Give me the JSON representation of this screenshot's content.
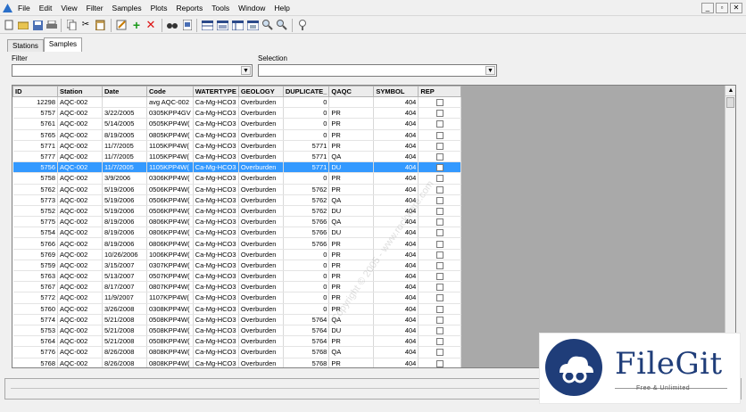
{
  "menu": [
    "File",
    "Edit",
    "View",
    "Filter",
    "Samples",
    "Plots",
    "Reports",
    "Tools",
    "Window",
    "Help"
  ],
  "window_buttons": [
    "_",
    "▫",
    "✕"
  ],
  "tabs": [
    "Stations",
    "Samples"
  ],
  "filter": {
    "label": "Filter",
    "value": ""
  },
  "selection": {
    "label": "Selection",
    "value": ""
  },
  "columns": [
    "ID",
    "Station",
    "Date",
    "Code",
    "WATERTYPE",
    "GEOLOGY",
    "DUPLICATE_",
    "QAQC",
    "SYMBOL",
    "REP"
  ],
  "rows": [
    {
      "id": "12298",
      "station": "AQC-002",
      "date": "",
      "code": "avg AQC-002",
      "watertype": "Ca-Mg-HCO3",
      "geology": "Overburden",
      "dup": "0",
      "qaqc": "",
      "symbol": "404"
    },
    {
      "id": "5757",
      "station": "AQC-002",
      "date": "3/22/2005",
      "code": "0305KPP4GV",
      "watertype": "Ca-Mg-HCO3",
      "geology": "Overburden",
      "dup": "0",
      "qaqc": "PR",
      "symbol": "404"
    },
    {
      "id": "5761",
      "station": "AQC-002",
      "date": "5/14/2005",
      "code": "0505KPP4W(",
      "watertype": "Ca-Mg-HCO3",
      "geology": "Overburden",
      "dup": "0",
      "qaqc": "PR",
      "symbol": "404"
    },
    {
      "id": "5765",
      "station": "AQC-002",
      "date": "8/19/2005",
      "code": "0805KPP4W(",
      "watertype": "Ca-Mg-HCO3",
      "geology": "Overburden",
      "dup": "0",
      "qaqc": "PR",
      "symbol": "404"
    },
    {
      "id": "5771",
      "station": "AQC-002",
      "date": "11/7/2005",
      "code": "1105KPP4W(",
      "watertype": "Ca-Mg-HCO3",
      "geology": "Overburden",
      "dup": "5771",
      "qaqc": "PR",
      "symbol": "404"
    },
    {
      "id": "5777",
      "station": "AQC-002",
      "date": "11/7/2005",
      "code": "1105KPP4W(",
      "watertype": "Ca-Mg-HCO3",
      "geology": "Overburden",
      "dup": "5771",
      "qaqc": "QA",
      "symbol": "404"
    },
    {
      "id": "5756",
      "station": "AQC-002",
      "date": "11/7/2005",
      "code": "1105KPP4W(",
      "watertype": "Ca-Mg-HCO3",
      "geology": "Overburden",
      "dup": "5771",
      "qaqc": "DU",
      "symbol": "404",
      "selected": true
    },
    {
      "id": "5758",
      "station": "AQC-002",
      "date": "3/9/2006",
      "code": "0306KPP4W(",
      "watertype": "Ca-Mg-HCO3",
      "geology": "Overburden",
      "dup": "0",
      "qaqc": "PR",
      "symbol": "404"
    },
    {
      "id": "5762",
      "station": "AQC-002",
      "date": "5/19/2006",
      "code": "0506KPP4W(",
      "watertype": "Ca-Mg-HCO3",
      "geology": "Overburden",
      "dup": "5762",
      "qaqc": "PR",
      "symbol": "404"
    },
    {
      "id": "5773",
      "station": "AQC-002",
      "date": "5/19/2006",
      "code": "0506KPP4W(",
      "watertype": "Ca-Mg-HCO3",
      "geology": "Overburden",
      "dup": "5762",
      "qaqc": "QA",
      "symbol": "404"
    },
    {
      "id": "5752",
      "station": "AQC-002",
      "date": "5/19/2006",
      "code": "0506KPP4W(",
      "watertype": "Ca-Mg-HCO3",
      "geology": "Overburden",
      "dup": "5762",
      "qaqc": "DU",
      "symbol": "404"
    },
    {
      "id": "5775",
      "station": "AQC-002",
      "date": "8/19/2006",
      "code": "0806KPP4W(",
      "watertype": "Ca-Mg-HCO3",
      "geology": "Overburden",
      "dup": "5766",
      "qaqc": "QA",
      "symbol": "404"
    },
    {
      "id": "5754",
      "station": "AQC-002",
      "date": "8/19/2006",
      "code": "0806KPP4W(",
      "watertype": "Ca-Mg-HCO3",
      "geology": "Overburden",
      "dup": "5766",
      "qaqc": "DU",
      "symbol": "404"
    },
    {
      "id": "5766",
      "station": "AQC-002",
      "date": "8/19/2006",
      "code": "0806KPP4W(",
      "watertype": "Ca-Mg-HCO3",
      "geology": "Overburden",
      "dup": "5766",
      "qaqc": "PR",
      "symbol": "404"
    },
    {
      "id": "5769",
      "station": "AQC-002",
      "date": "10/26/2006",
      "code": "1006KPP4W(",
      "watertype": "Ca-Mg-HCO3",
      "geology": "Overburden",
      "dup": "0",
      "qaqc": "PR",
      "symbol": "404"
    },
    {
      "id": "5759",
      "station": "AQC-002",
      "date": "3/15/2007",
      "code": "0307KPP4W(",
      "watertype": "Ca-Mg-HCO3",
      "geology": "Overburden",
      "dup": "0",
      "qaqc": "PR",
      "symbol": "404"
    },
    {
      "id": "5763",
      "station": "AQC-002",
      "date": "5/13/2007",
      "code": "0507KPP4W(",
      "watertype": "Ca-Mg-HCO3",
      "geology": "Overburden",
      "dup": "0",
      "qaqc": "PR",
      "symbol": "404"
    },
    {
      "id": "5767",
      "station": "AQC-002",
      "date": "8/17/2007",
      "code": "0807KPP4W(",
      "watertype": "Ca-Mg-HCO3",
      "geology": "Overburden",
      "dup": "0",
      "qaqc": "PR",
      "symbol": "404"
    },
    {
      "id": "5772",
      "station": "AQC-002",
      "date": "11/9/2007",
      "code": "1107KPP4W(",
      "watertype": "Ca-Mg-HCO3",
      "geology": "Overburden",
      "dup": "0",
      "qaqc": "PR",
      "symbol": "404"
    },
    {
      "id": "5760",
      "station": "AQC-002",
      "date": "3/26/2008",
      "code": "0308KPP4W(",
      "watertype": "Ca-Mg-HCO3",
      "geology": "Overburden",
      "dup": "0",
      "qaqc": "PR",
      "symbol": "404"
    },
    {
      "id": "5774",
      "station": "AQC-002",
      "date": "5/21/2008",
      "code": "0508KPP4W(",
      "watertype": "Ca-Mg-HCO3",
      "geology": "Overburden",
      "dup": "5764",
      "qaqc": "QA",
      "symbol": "404"
    },
    {
      "id": "5753",
      "station": "AQC-002",
      "date": "5/21/2008",
      "code": "0508KPP4W(",
      "watertype": "Ca-Mg-HCO3",
      "geology": "Overburden",
      "dup": "5764",
      "qaqc": "DU",
      "symbol": "404"
    },
    {
      "id": "5764",
      "station": "AQC-002",
      "date": "5/21/2008",
      "code": "0508KPP4W(",
      "watertype": "Ca-Mg-HCO3",
      "geology": "Overburden",
      "dup": "5764",
      "qaqc": "PR",
      "symbol": "404"
    },
    {
      "id": "5776",
      "station": "AQC-002",
      "date": "8/26/2008",
      "code": "0808KPP4W(",
      "watertype": "Ca-Mg-HCO3",
      "geology": "Overburden",
      "dup": "5768",
      "qaqc": "QA",
      "symbol": "404"
    },
    {
      "id": "5768",
      "station": "AQC-002",
      "date": "8/26/2008",
      "code": "0808KPP4W(",
      "watertype": "Ca-Mg-HCO3",
      "geology": "Overburden",
      "dup": "5768",
      "qaqc": "PR",
      "symbol": "404"
    }
  ],
  "watermark": "Copyright © 2005 - www.rockware.com",
  "badge": {
    "title": "FileGit",
    "subtitle": "Free & Unlimited"
  },
  "colors": {
    "selected_row": "#3399ff",
    "grid_background": "#a9a9a9",
    "brand": "#1f3d79"
  }
}
